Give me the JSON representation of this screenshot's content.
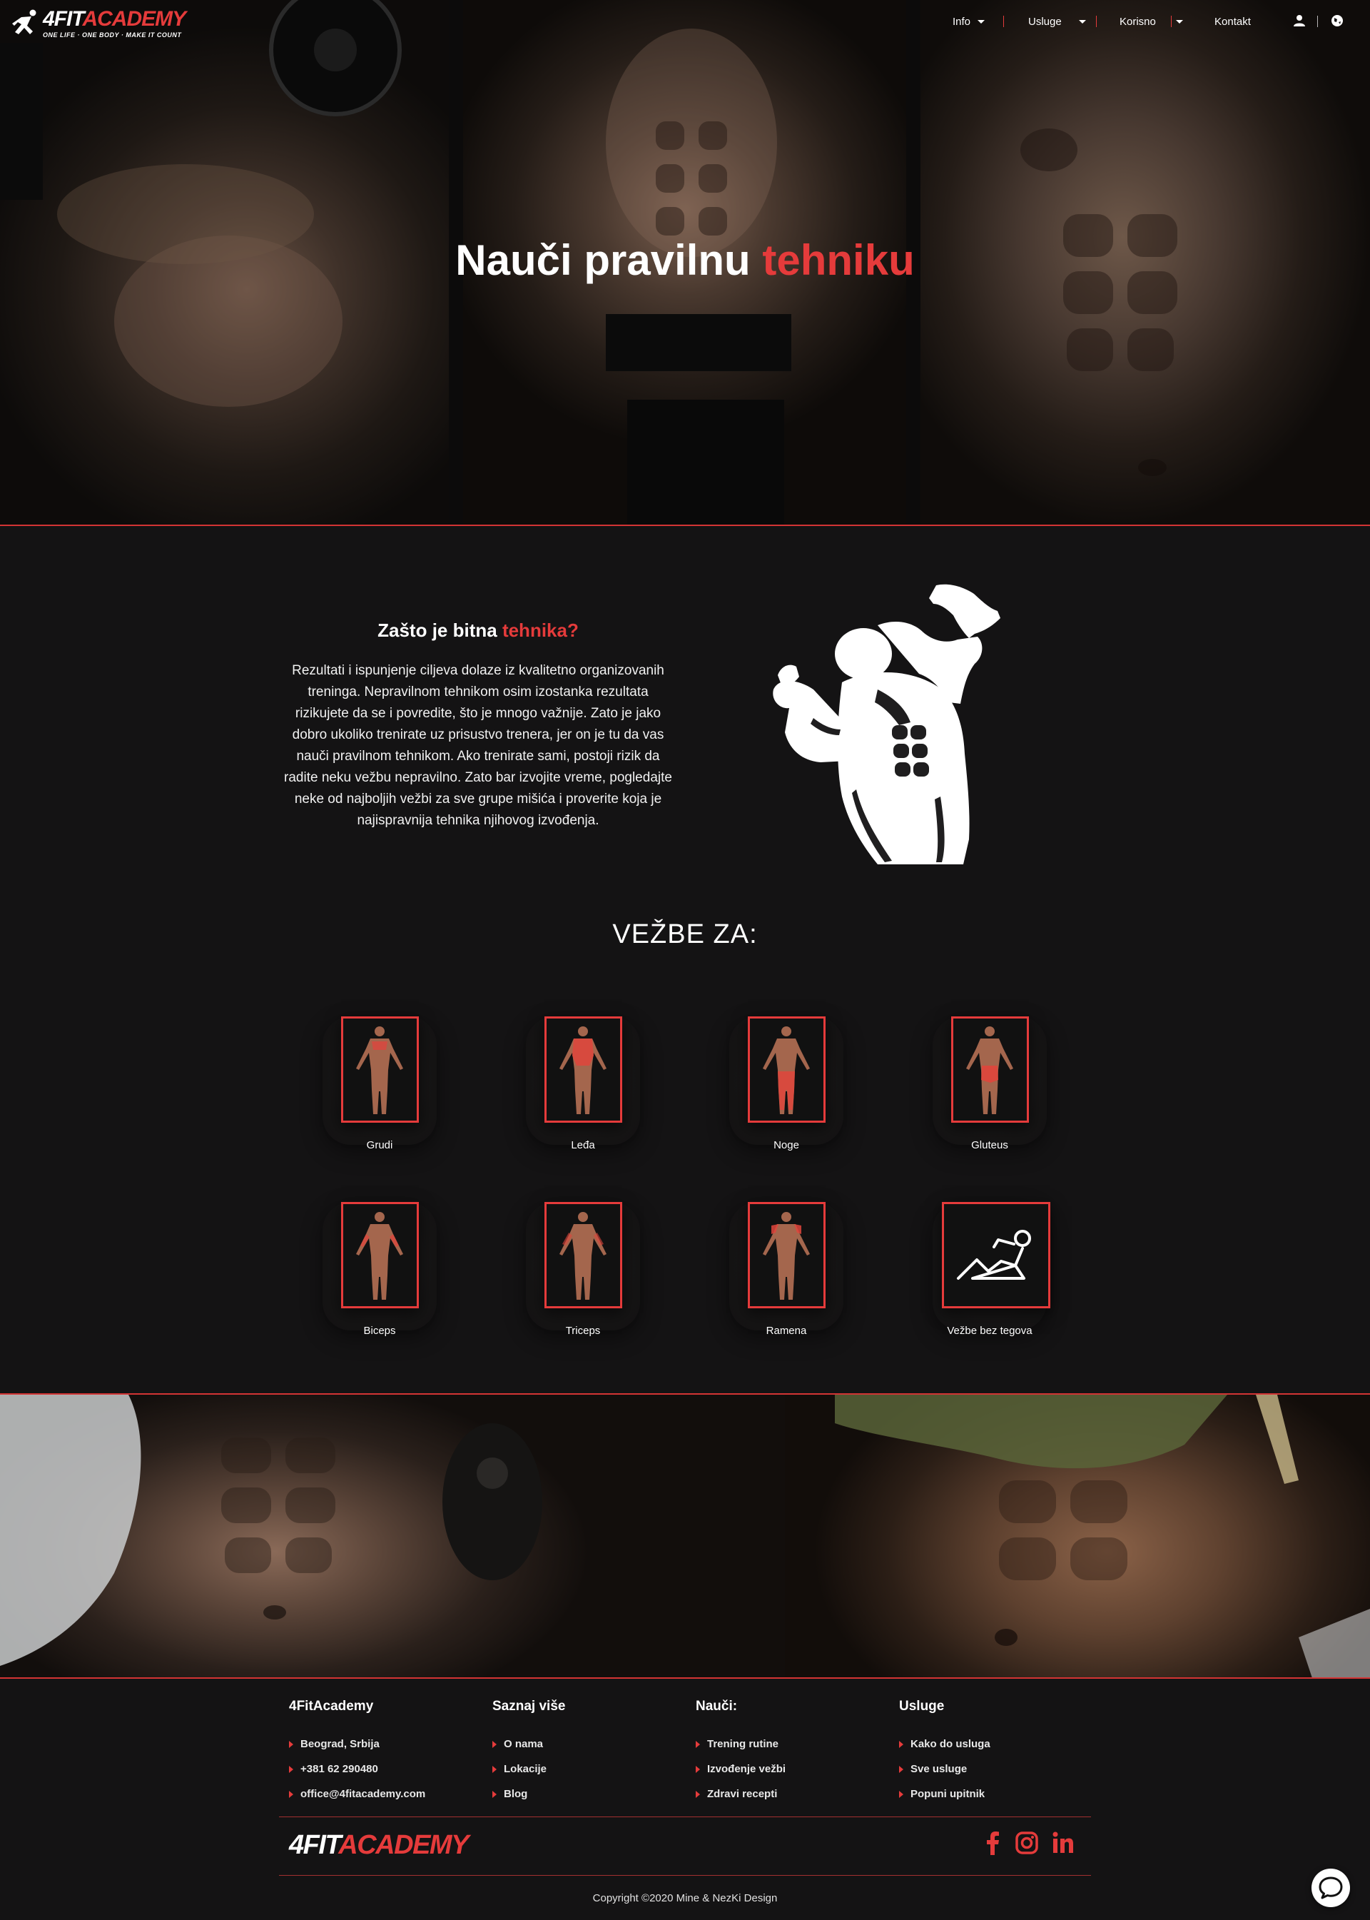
{
  "brand": {
    "logo_white": "4FIT",
    "logo_red": "ACADEMY",
    "tagline": "ONE LIFE · ONE BODY · MAKE IT COUNT"
  },
  "nav": {
    "items": [
      {
        "label": "Info",
        "dropdown": true
      },
      {
        "label": "Usluge",
        "dropdown": true
      },
      {
        "label": "Korisno",
        "dropdown": true
      },
      {
        "label": "Kontakt",
        "dropdown": false
      }
    ],
    "icons": [
      "user-icon",
      "globe-icon"
    ]
  },
  "hero": {
    "title_white": "Nauči pravilnu ",
    "title_red": "tehniku"
  },
  "why": {
    "title_white": "Zašto je bitna ",
    "title_red": "tehnika?",
    "text": "Rezultati i ispunjenje ciljeva dolaze iz kvalitetno organizovanih treninga. Nepravilnom tehnikom osim izostanka rezultata rizikujete da se i povredite, što je mnogo važnije. Zato je jako dobro ukoliko trenirate uz prisustvo trenera, jer on je tu da vas nauči pravilnom tehnikom. Ako trenirate sami, postoji rizik da radite neku vežbu nepravilno. Zato bar izvojite vreme, pogledajte neke od najboljih vežbi za sve grupe mišića i proverite koja je najispravnija tehnika njihovog izvođenja."
  },
  "exercises": {
    "title": "VEŽBE ZA:",
    "items": [
      {
        "label": "Grudi",
        "icon": "chest-muscle-icon"
      },
      {
        "label": "Leđa",
        "icon": "back-muscle-icon"
      },
      {
        "label": "Noge",
        "icon": "legs-muscle-icon"
      },
      {
        "label": "Gluteus",
        "icon": "gluteus-muscle-icon"
      },
      {
        "label": "Biceps",
        "icon": "biceps-muscle-icon"
      },
      {
        "label": "Triceps",
        "icon": "triceps-muscle-icon"
      },
      {
        "label": "Ramena",
        "icon": "shoulders-muscle-icon"
      },
      {
        "label": "Vežbe bez tegova",
        "icon": "situp-icon"
      }
    ]
  },
  "footer": {
    "columns": [
      {
        "title": "4FitAcademy",
        "links": [
          "Beograd, Srbija",
          "+381 62 290480",
          "office@4fitacademy.com"
        ]
      },
      {
        "title": "Saznaj više",
        "links": [
          "O nama",
          "Lokacije",
          "Blog"
        ]
      },
      {
        "title": "Nauči:",
        "links": [
          "Trening rutine",
          "Izvođenje vežbi",
          "Zdravi recepti"
        ]
      },
      {
        "title": "Usluge",
        "links": [
          "Kako do usluga",
          "Sve usluge",
          "Popuni upitnik"
        ]
      }
    ],
    "logo_white": "4FIT",
    "logo_red": "ACADEMY",
    "social": [
      "facebook-icon",
      "instagram-icon",
      "linkedin-icon"
    ],
    "copyright": "Copyright ©2020 Mine & NezKi Design"
  },
  "colors": {
    "accent": "#e53b3b",
    "background": "#141314"
  }
}
